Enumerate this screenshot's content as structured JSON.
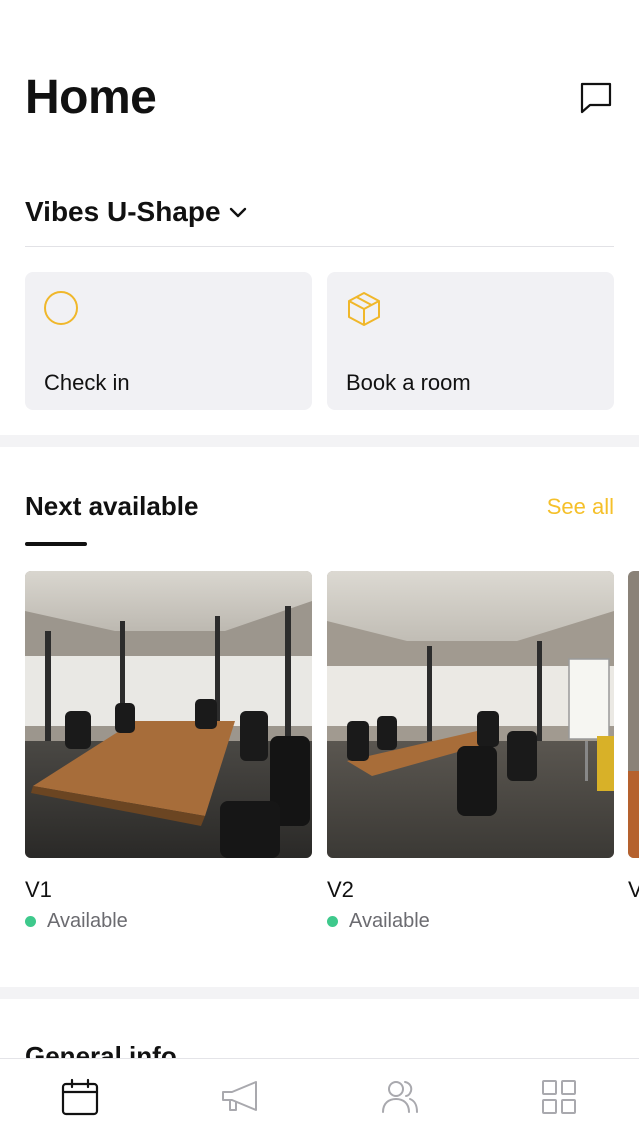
{
  "header": {
    "title": "Home"
  },
  "location": {
    "name": "Vibes U-Shape"
  },
  "actions": [
    {
      "label": "Check in",
      "icon": "circle-icon"
    },
    {
      "label": "Book a room",
      "icon": "cube-icon"
    }
  ],
  "next_available": {
    "title": "Next available",
    "see_all": "See all",
    "rooms": [
      {
        "name": "V1",
        "status": "Available"
      },
      {
        "name": "V2",
        "status": "Available"
      },
      {
        "name": "V"
      }
    ]
  },
  "general_info": {
    "title": "General info"
  },
  "tabs": [
    "calendar-icon",
    "megaphone-icon",
    "people-icon",
    "grid-icon"
  ],
  "colors": {
    "accent": "#f5c02a",
    "available": "#3ec98c",
    "card_bg": "#f1f1f4"
  }
}
